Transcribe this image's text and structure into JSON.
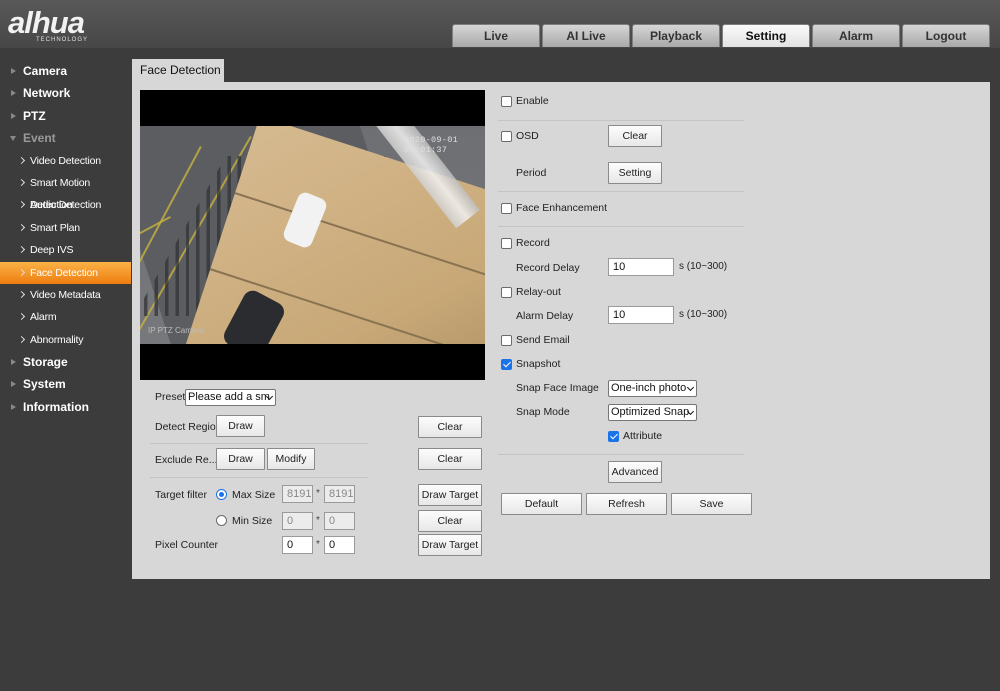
{
  "brand": {
    "name": "alhua",
    "tagline": "TECHNOLOGY"
  },
  "nav": {
    "tabs": [
      {
        "label": "Live"
      },
      {
        "label": "AI Live"
      },
      {
        "label": "Playback"
      },
      {
        "label": "Setting"
      },
      {
        "label": "Alarm"
      },
      {
        "label": "Logout"
      }
    ],
    "active": "Setting"
  },
  "sidebar": {
    "camera": "Camera",
    "network": "Network",
    "ptz": "PTZ",
    "event": "Event",
    "event_items": [
      "Video Detection",
      "Smart Motion Detection",
      "Audio Detection",
      "Smart Plan",
      "Deep IVS",
      "Face Detection",
      "Video Metadata",
      "Alarm",
      "Abnormality"
    ],
    "storage": "Storage",
    "system": "System",
    "information": "Information",
    "active_item": "Face Detection",
    "active_color": "#f39a24"
  },
  "page": {
    "tab_title": "Face Detection"
  },
  "video": {
    "timestamp": "2020-09-01 07:01:37",
    "camera_label": "IP PTZ Camera"
  },
  "left": {
    "preset_label": "Preset",
    "preset_value": "Please add a sm",
    "detect_region_label": "Detect Region",
    "exclude_region_label": "Exclude Re...",
    "draw_label": "Draw",
    "modify_label": "Modify",
    "clear_label": "Clear",
    "target_filter_label": "Target filter",
    "max_size_label": "Max Size",
    "min_size_label": "Min Size",
    "max_w": "8191",
    "max_h": "8191",
    "min_w": "0",
    "min_h": "0",
    "pixel_counter_label": "Pixel Counter",
    "pixel_w": "0",
    "pixel_h": "0",
    "draw_target_label": "Draw Target",
    "separator": "*",
    "max_size_selected": true
  },
  "right": {
    "enable_label": "Enable",
    "enable_checked": false,
    "osd_label": "OSD",
    "osd_checked": false,
    "clear_label": "Clear",
    "period_label": "Period",
    "setting_label": "Setting",
    "face_enhancement_label": "Face Enhancement",
    "face_enhancement_checked": false,
    "record_label": "Record",
    "record_checked": false,
    "record_delay_label": "Record Delay",
    "record_delay_value": "10",
    "record_delay_range": "s (10~300)",
    "relay_out_label": "Relay-out",
    "relay_out_checked": false,
    "alarm_delay_label": "Alarm Delay",
    "alarm_delay_value": "10",
    "alarm_delay_range": "s (10~300)",
    "send_email_label": "Send Email",
    "send_email_checked": false,
    "snapshot_label": "Snapshot",
    "snapshot_checked": true,
    "snap_face_image_label": "Snap Face Image",
    "snap_face_image_value": "One-inch photo",
    "snap_mode_label": "Snap Mode",
    "snap_mode_value": "Optimized Snap",
    "attribute_label": "Attribute",
    "attribute_checked": true,
    "advanced_label": "Advanced"
  },
  "actions": {
    "default_label": "Default",
    "refresh_label": "Refresh",
    "save_label": "Save"
  }
}
